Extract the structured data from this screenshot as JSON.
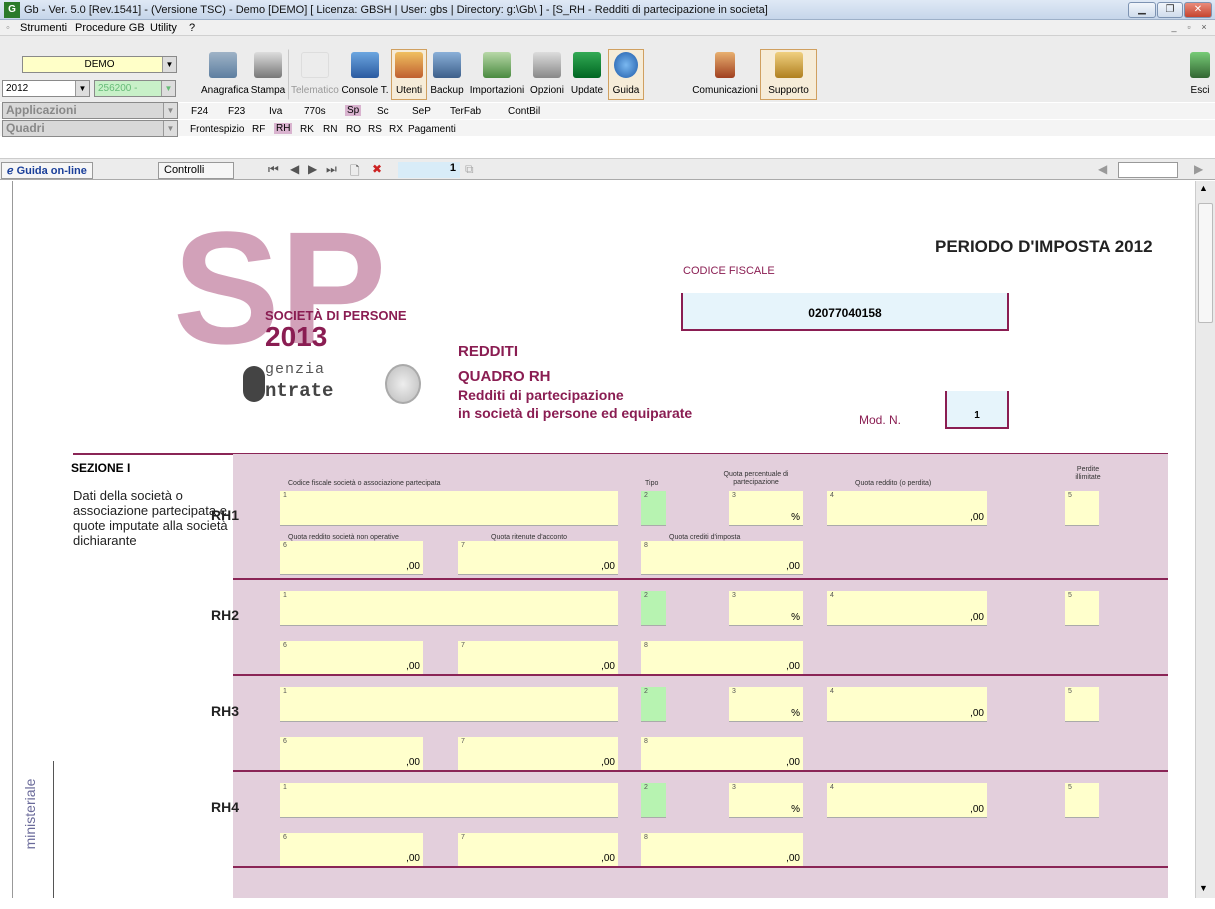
{
  "window": {
    "title": "Gb - Ver. 5.0 [Rev.1541] - (Versione TSC) - Demo [DEMO]     [ Licenza: GBSH | User: gbs | Directory: g:\\Gb\\ ] - [S_RH - Redditi di partecipazione in societa]",
    "app_icon": "G"
  },
  "menu": {
    "items": [
      "Strumenti",
      "Procedure GB",
      "Utility",
      "?"
    ]
  },
  "toolbar": {
    "company": "DEMO",
    "year": "2012",
    "code": "256200 -",
    "buttons": [
      "Anagrafica",
      "Stampa",
      "Telematico",
      "Console T.",
      "Utenti",
      "Backup",
      "Importazioni",
      "Opzioni",
      "Update",
      "Guida",
      "Comunicazioni",
      "Supporto",
      "Esci"
    ]
  },
  "applicazioni": {
    "label": "Applicazioni",
    "tabs": [
      "F24",
      "F23",
      "Iva",
      "770s",
      "Sp",
      "Sc",
      "SeP",
      "TerFab",
      "ContBil"
    ],
    "active": "Sp"
  },
  "quadri": {
    "label": "Quadri",
    "tabs": [
      "Frontespizio",
      "RF",
      "RH",
      "RK",
      "RN",
      "RO",
      "RS",
      "RX",
      "Pagamenti"
    ],
    "active": "RH"
  },
  "navbar": {
    "guida": "Guida on-line",
    "controlli": "Controlli",
    "page": "1"
  },
  "header": {
    "periodo": "PERIODO D'IMPOSTA 2012",
    "codice_fiscale_label": "CODICE FISCALE",
    "codice_fiscale": "02077040158",
    "logo_letters": "SP",
    "logo_title": "SOCIETÀ DI PERSONE",
    "logo_year": "2013",
    "agenzia_1": "genzia",
    "agenzia_2": "ntrate",
    "redditi": "REDDITI",
    "quadro": "QUADRO RH",
    "desc1": "Redditi di partecipazione",
    "desc2": "in società di persone ed equiparate",
    "mod_label": "Mod. N.",
    "mod_value": "1"
  },
  "section": {
    "title": "SEZIONE I",
    "desc": "Dati della società o associazione partecipata e quote imputate alla società dichiarante"
  },
  "side_label": "ministeriale",
  "columns": {
    "c1": "Codice fiscale società o associazione partecipata",
    "c2": "Tipo",
    "c3": "Quota percentuale di partecipazione",
    "c4": "Quota reddito (o perdita)",
    "c5": "Perdite illimitate",
    "c6": "Quota reddito società non operative",
    "c7": "Quota ritenute d'acconto",
    "c8": "Quota crediti d'imposta"
  },
  "rows": [
    "RH1",
    "RH2",
    "RH3",
    "RH4"
  ],
  "suffix": {
    "cents": ",00",
    "percent": "%"
  },
  "field_numbers": [
    "1",
    "2",
    "3",
    "4",
    "5",
    "6",
    "7",
    "8"
  ]
}
